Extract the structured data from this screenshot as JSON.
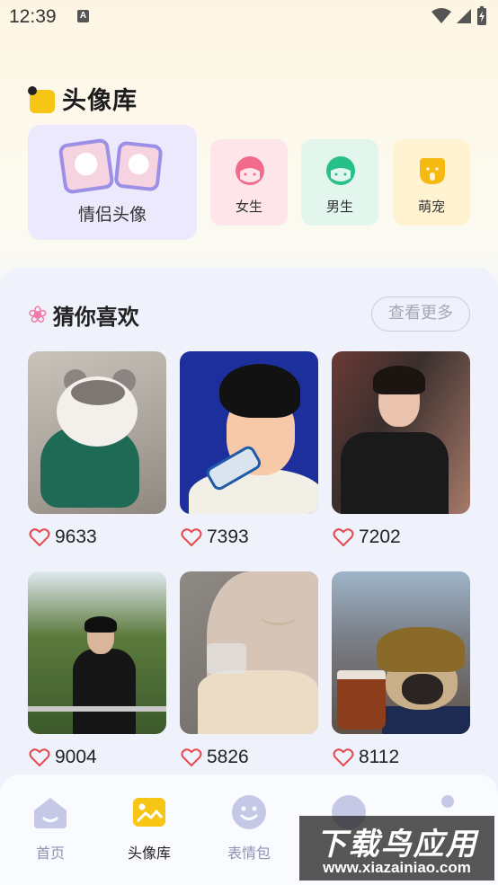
{
  "status_bar": {
    "time": "12:39",
    "notification_icon": "A"
  },
  "header": {
    "title": "头像库"
  },
  "categories": {
    "couple": {
      "label": "情侣头像"
    },
    "girl": {
      "label": "女生"
    },
    "boy": {
      "label": "男生"
    },
    "pet": {
      "label": "萌宠"
    }
  },
  "recommend": {
    "title": "猜你喜欢",
    "more_label": "查看更多",
    "items": [
      {
        "name": "cat-avatar",
        "likes": "9633"
      },
      {
        "name": "drawing-avatar",
        "likes": "7393"
      },
      {
        "name": "boy-avatar",
        "likes": "7202"
      },
      {
        "name": "outdoor-boy-avatar",
        "likes": "9004"
      },
      {
        "name": "girl-avatar",
        "likes": "5826"
      },
      {
        "name": "pug-avatar",
        "likes": "8112"
      }
    ]
  },
  "bottom_nav": {
    "items": [
      {
        "label": "首页",
        "icon": "home-icon",
        "active": false
      },
      {
        "label": "头像库",
        "icon": "image-icon",
        "active": true
      },
      {
        "label": "表情包",
        "icon": "smile-icon",
        "active": false
      }
    ]
  },
  "watermark": {
    "line1": "下载鸟应用",
    "line2": "www.xiazainiao.com"
  },
  "colors": {
    "accent_yellow": "#f7c514",
    "heart_red": "#e5484d",
    "nav_inactive": "#8e93b3"
  }
}
